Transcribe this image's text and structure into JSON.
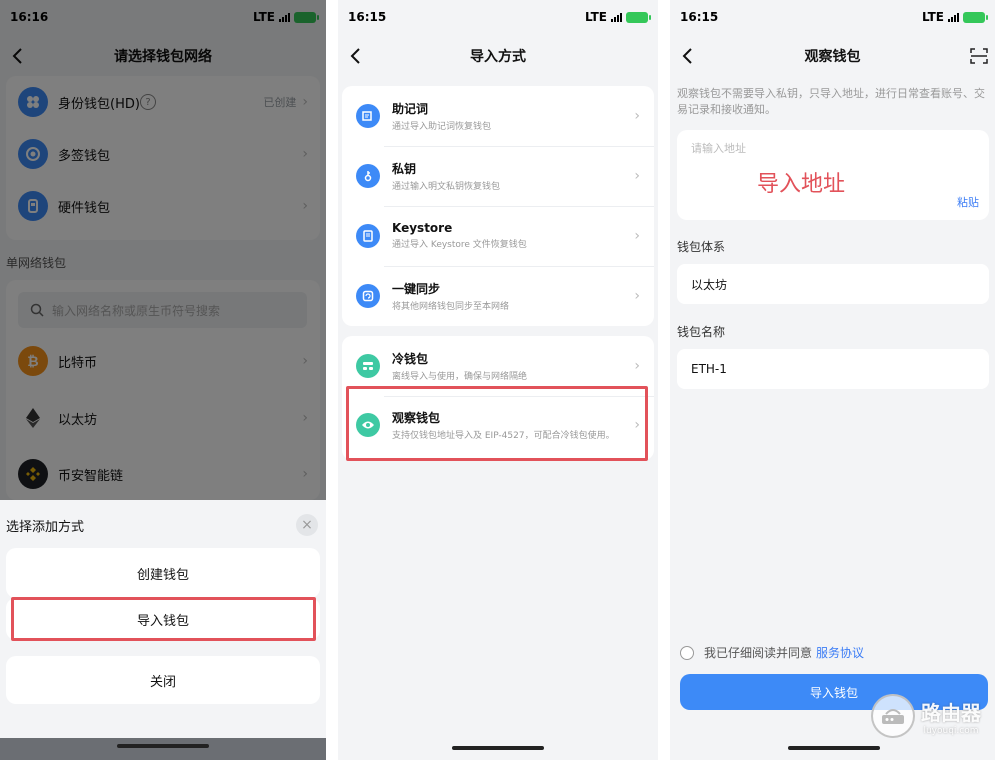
{
  "screen1": {
    "status": {
      "time": "16:16",
      "network": "LTE"
    },
    "title": "请选择钱包网络",
    "top_items": [
      {
        "label": "身份钱包(HD)",
        "meta": "已创建",
        "icon": "identity-wallet-icon",
        "color": "#3d8af7"
      },
      {
        "label": "多签钱包",
        "meta": "",
        "icon": "multisig-wallet-icon",
        "color": "#3d8af7"
      },
      {
        "label": "硬件钱包",
        "meta": "",
        "icon": "hardware-wallet-icon",
        "color": "#3d8af7"
      }
    ],
    "section_title": "单网络钱包",
    "search_placeholder": "输入网络名称或原生币符号搜索",
    "networks": [
      {
        "label": "比特币",
        "icon": "bitcoin-icon",
        "color": "#f7931a"
      },
      {
        "label": "以太坊",
        "icon": "ethereum-icon",
        "color": "#627eea"
      },
      {
        "label": "币安智能链",
        "icon": "bnb-icon",
        "color": "#f0b90b"
      }
    ],
    "sheet": {
      "title": "选择添加方式",
      "create_label": "创建钱包",
      "import_label": "导入钱包",
      "close_label": "关闭"
    }
  },
  "screen2": {
    "status": {
      "time": "16:15",
      "network": "LTE"
    },
    "title": "导入方式",
    "group1": [
      {
        "title": "助记词",
        "sub": "通过导入助记词恢复钱包",
        "icon": "mnemonic-icon",
        "color": "#3d8af7"
      },
      {
        "title": "私钥",
        "sub": "通过输入明文私钥恢复钱包",
        "icon": "key-icon",
        "color": "#3d8af7"
      },
      {
        "title": "Keystore",
        "sub": "通过导入 Keystore 文件恢复钱包",
        "icon": "keystore-icon",
        "color": "#3d8af7"
      },
      {
        "title": "一键同步",
        "sub": "将其他网络钱包同步至本网络",
        "icon": "sync-icon",
        "color": "#3d8af7"
      }
    ],
    "group2": [
      {
        "title": "冷钱包",
        "sub": "离线导入与使用，确保与网络隔绝",
        "icon": "cold-wallet-icon",
        "color": "#3ec9a3"
      },
      {
        "title": "观察钱包",
        "sub": "支持仅钱包地址导入及 EIP-4527，可配合冷钱包使用。",
        "icon": "eye-icon",
        "color": "#3ec9a3"
      }
    ]
  },
  "screen3": {
    "status": {
      "time": "16:15",
      "network": "LTE"
    },
    "title": "观察钱包",
    "description": "观察钱包不需要导入私钥，只导入地址，进行日常查看账号、交易记录和接收通知。",
    "address_placeholder": "请输入地址",
    "annotation": "导入地址",
    "paste_label": "粘贴",
    "system_label": "钱包体系",
    "system_value": "以太坊",
    "name_label": "钱包名称",
    "name_value": "ETH-1",
    "agree_text": "我已仔细阅读并同意",
    "agree_link": "服务协议",
    "import_button": "导入钱包"
  },
  "watermark": {
    "text": "路由器",
    "domain": "luyouqi.com"
  },
  "colors": {
    "highlight": "#e2525a",
    "accent": "#3d8af7"
  }
}
